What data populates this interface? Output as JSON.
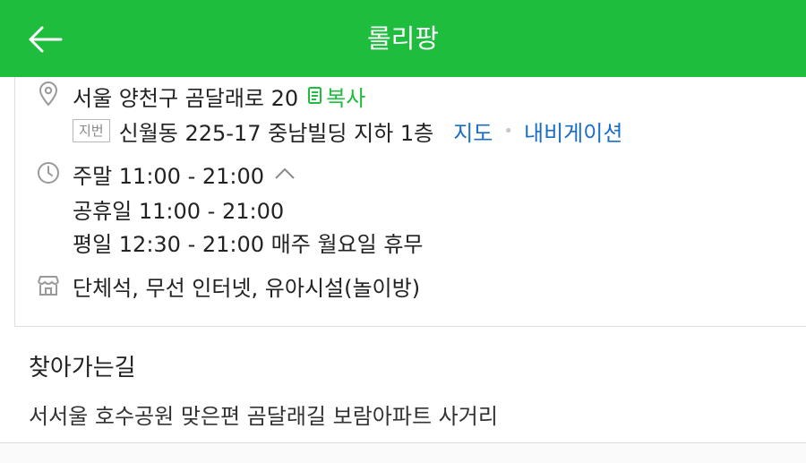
{
  "header": {
    "title": "롤리팡",
    "back_icon": "arrow-left-icon",
    "background_color": "#1ebd3e"
  },
  "address": {
    "road": "서울 양천구 곰달래로 20",
    "copy_label": "복사",
    "jibun_tag": "지번",
    "jibun": "신월동 225-17 중남빌딩 지하 1층",
    "map_link": "지도",
    "navigation_link": "내비게이션"
  },
  "hours": {
    "weekend": "주말 11:00 - 21:00",
    "holiday": "공휴일 11:00 - 21:00",
    "weekday": "평일 12:30 - 21:00 매주 월요일 휴무"
  },
  "facilities": "단체석, 무선 인터넷, 유아시설(놀이방)",
  "directions": {
    "title": "찾아가는길",
    "text": "서서울 호수공원 맞은편 곰달래길 보람아파트 사거리"
  },
  "colors": {
    "accent": "#1ebd3e",
    "link": "#1a6dc4"
  }
}
